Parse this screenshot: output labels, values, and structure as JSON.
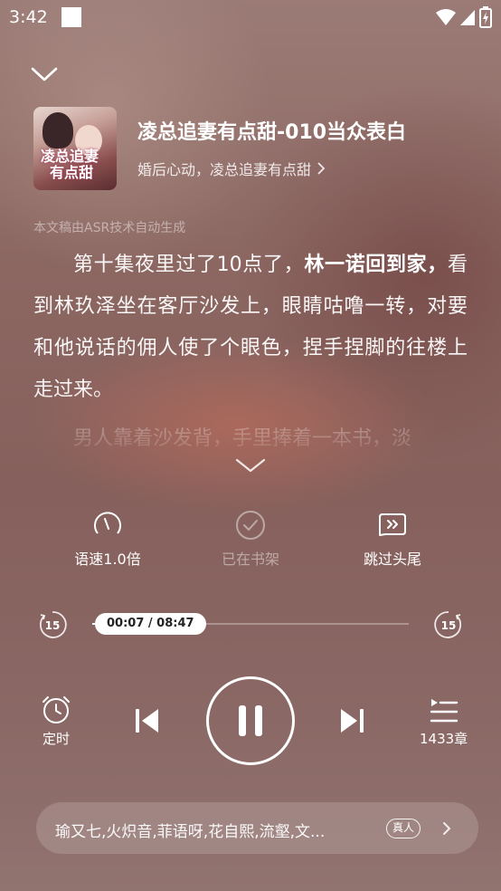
{
  "status": {
    "time": "3:42"
  },
  "book": {
    "cover_text_line1": "凌总追妻",
    "cover_text_line2": "有点甜",
    "title": "凌总追妻有点甜-010当众表白",
    "subtitle": "婚后心动，凌总追妻有点甜"
  },
  "article": {
    "asr_note": "本文稿由ASR技术自动生成",
    "p1_a": "第十集夜里过了10点了，",
    "p1_bold": "林一诺回到家，",
    "p1_b": "看到林玖泽坐在客厅沙发上，眼睛咕噜一转，对要和他说话的佣人使了个眼色，捏手捏脚的往楼上走过来。",
    "p2": "男人靠着沙发背，手里捧着一本书，淡"
  },
  "tools": {
    "speed": "语速1.0倍",
    "shelf": "已在书架",
    "skip_intro": "跳过头尾"
  },
  "progress": {
    "back_seconds": "15",
    "forward_seconds": "15",
    "time_label": "00:07 / 08:47",
    "fraction": 0.0133
  },
  "controls": {
    "timer": "定时",
    "chapters": "1433章"
  },
  "voice": {
    "names": "瑜又七,火炽音,菲语呀,花自熙,流壑,文...",
    "tag": "真人"
  }
}
